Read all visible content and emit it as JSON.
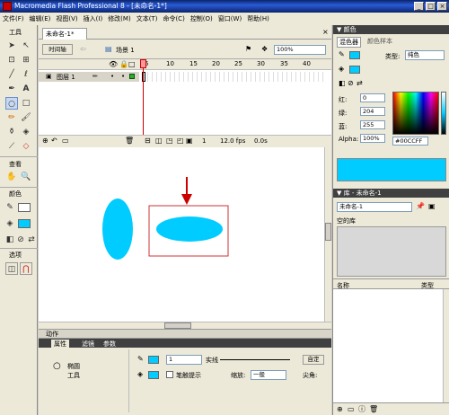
{
  "window": {
    "title": "Macromedia Flash Professional 8 - [未命名-1*]"
  },
  "menu": [
    "文件(F)",
    "编辑(E)",
    "视图(V)",
    "插入(I)",
    "修改(M)",
    "文本(T)",
    "命令(C)",
    "控制(O)",
    "窗口(W)",
    "帮助(H)"
  ],
  "tools": {
    "header": "工具",
    "view_header": "查看",
    "color_header": "颜色",
    "options_header": "选项"
  },
  "document": {
    "tab": "未命名-1*",
    "timeline_button": "时间轴",
    "scene": "场景 1",
    "zoom": "100%",
    "layer": "图层 1",
    "frame_numbers": [
      "5",
      "10",
      "15",
      "20",
      "25",
      "30",
      "35",
      "40"
    ],
    "frame": "1",
    "fps": "12.0 fps",
    "time": "0.0s"
  },
  "actions_label": "动作",
  "properties": {
    "tabs": [
      "属性",
      "滤镜",
      "参数"
    ],
    "tool_name": "椭圆",
    "tool_sub": "工具",
    "stroke_width": "1",
    "stroke_style": "实线",
    "custom_button": "自定",
    "hint_label": "笔触提示",
    "scale_label": "缩放:",
    "scale_value": "一般",
    "cap_label": "尖角:"
  },
  "color_panel": {
    "title": "颜色",
    "tabs": [
      "混色器",
      "颜色样本"
    ],
    "type_label": "类型:",
    "type_value": "纯色",
    "red_label": "红:",
    "red": "0",
    "green_label": "绿:",
    "green": "204",
    "blue_label": "蓝:",
    "blue": "255",
    "alpha_label": "Alpha:",
    "alpha": "100%",
    "hex": "#00CCFF"
  },
  "library": {
    "title": "库 - 未命名-1",
    "doc_select": "未命名-1",
    "empty_label": "空的库",
    "col_name": "名称",
    "col_type": "类型"
  },
  "colors": {
    "fill": "#00ccff",
    "accent": "#0a246a",
    "arrow": "#cc0000"
  }
}
